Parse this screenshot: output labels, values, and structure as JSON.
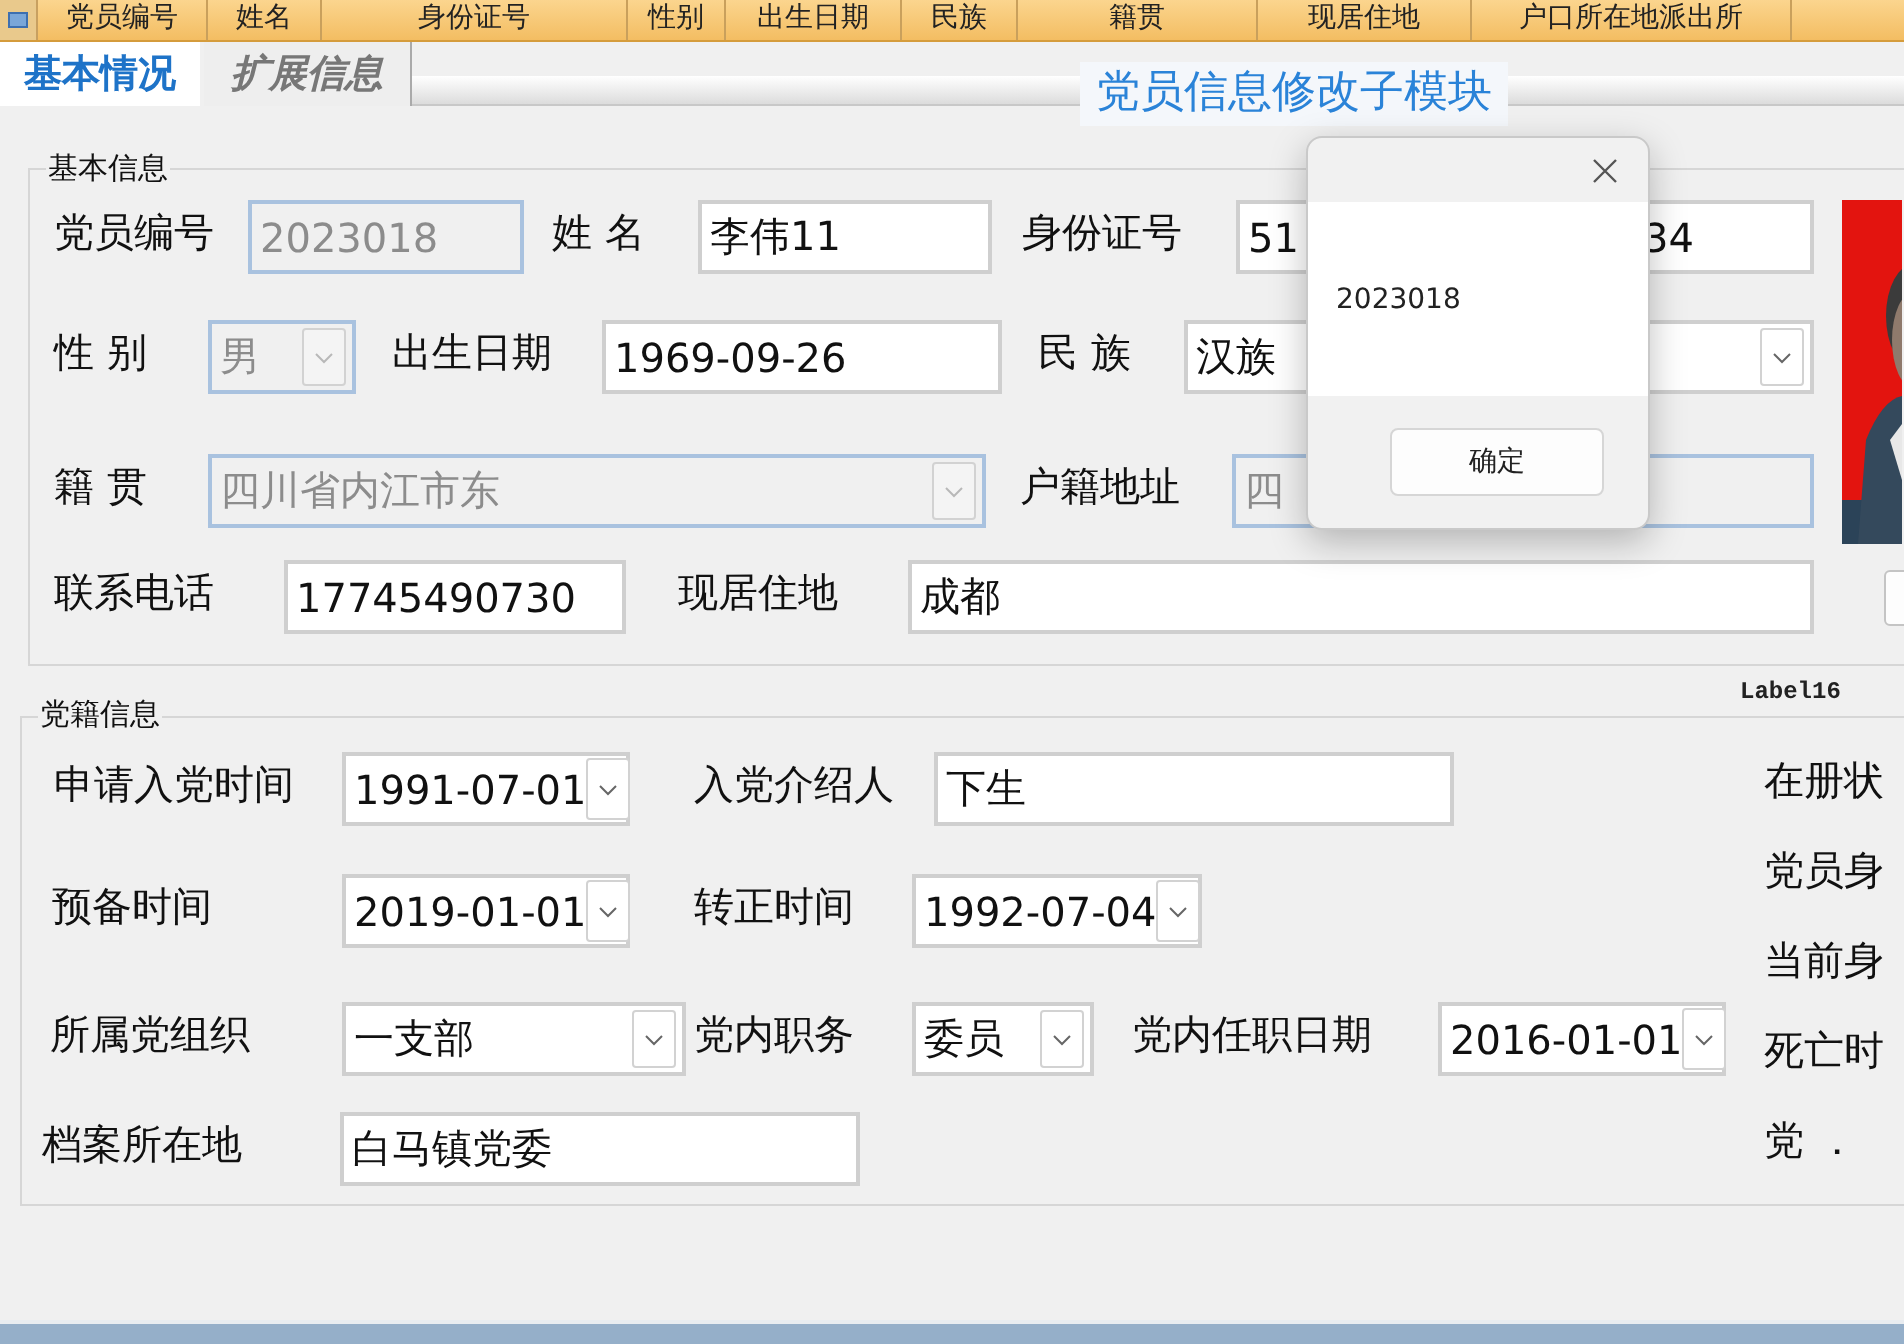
{
  "grid_header": {
    "columns": [
      "党员编号",
      "姓名",
      "身份证号",
      "性别",
      "出生日期",
      "民族",
      "籍贯",
      "现居住地",
      "户口所在地派出所"
    ]
  },
  "tabs": [
    {
      "label": "基本情况",
      "selected": true
    },
    {
      "label": "扩展信息",
      "selected": false
    }
  ],
  "module_title": "党员信息修改子模块",
  "groups": [
    {
      "legend": "基本信息",
      "fields": [
        {
          "label": "党员编号",
          "kind": "text",
          "value": "2023018",
          "disabled": true
        },
        {
          "label": "姓 名",
          "kind": "text",
          "value": "李伟11",
          "disabled": false
        },
        {
          "label": "身份证号",
          "kind": "text",
          "value": "51",
          "value_tail": "34",
          "disabled": false
        },
        {
          "label": "性 别",
          "kind": "combo",
          "value": "男",
          "disabled": true
        },
        {
          "label": "出生日期",
          "kind": "text",
          "value": "1969-09-26",
          "disabled": false
        },
        {
          "label": "民 族",
          "kind": "combo",
          "value": "汉族",
          "disabled": false
        },
        {
          "label": "籍 贯",
          "kind": "combo",
          "value": "四川省内江市东",
          "disabled": true
        },
        {
          "label": "户籍地址",
          "kind": "text",
          "value": "四",
          "disabled": true
        },
        {
          "label": "联系电话",
          "kind": "text",
          "value": "17745490730",
          "disabled": false
        },
        {
          "label": "现居住地",
          "kind": "text",
          "value": "成都",
          "disabled": false
        }
      ]
    },
    {
      "legend": "党籍信息",
      "fields": [
        {
          "label": "申请入党时间",
          "kind": "date",
          "value": "1991-07-01",
          "disabled": false
        },
        {
          "label": "入党介绍人",
          "kind": "text",
          "value": "下生",
          "disabled": false
        },
        {
          "label": "预备时间",
          "kind": "date",
          "value": "2019-01-01",
          "disabled": false
        },
        {
          "label": "转正时间",
          "kind": "date",
          "value": "1992-07-04",
          "disabled": false
        },
        {
          "label": "所属党组织",
          "kind": "combo",
          "value": "一支部",
          "disabled": false
        },
        {
          "label": "党内职务",
          "kind": "combo",
          "value": "委员",
          "disabled": false
        },
        {
          "label": "党内任职日期",
          "kind": "date",
          "value": "2016-01-01",
          "disabled": false
        },
        {
          "label": "档案所在地",
          "kind": "text",
          "value": "白马镇党委",
          "disabled": false
        }
      ],
      "side_labels": [
        "在册状",
        "党员身",
        "当前身",
        "死亡时",
        "党 ．"
      ]
    }
  ],
  "corner_label": "Label16",
  "dialog": {
    "message": "2023018",
    "button": "确定"
  }
}
